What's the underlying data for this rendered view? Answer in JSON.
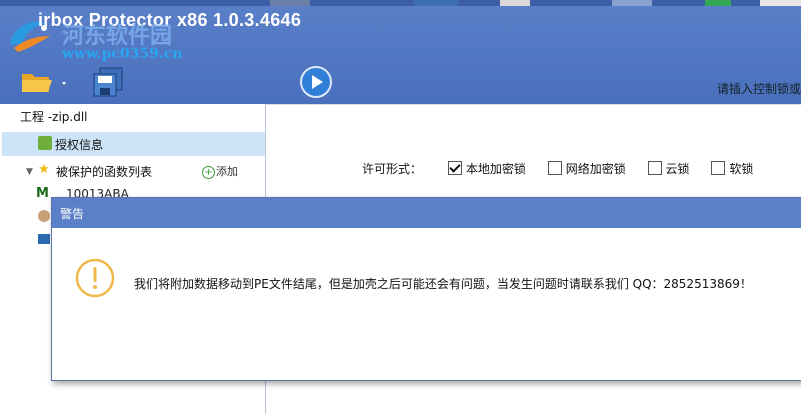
{
  "window": {
    "title": "irbox Protector x86  1.0.3.4646",
    "watermark_line1": "河东软件园",
    "watermark_line2": "www.pc0359.cn",
    "hint": "请插入控制锁或"
  },
  "toolbar": {
    "open_icon": "folder-open-icon",
    "save_icon": "save-all-icon",
    "run_icon": "play-icon"
  },
  "tree": {
    "project": "工程 -zip.dll",
    "auth_info": "授权信息",
    "protected_funcs": "被保护的函数列表",
    "add_label": "添加",
    "func1": "10013ABA"
  },
  "license": {
    "label": "许可形式：",
    "options": [
      {
        "label": "本地加密锁",
        "checked": true
      },
      {
        "label": "网络加密锁",
        "checked": false
      },
      {
        "label": "云锁",
        "checked": false
      },
      {
        "label": "软锁",
        "checked": false
      }
    ]
  },
  "dialog": {
    "title": "警告",
    "message": "我们将附加数据移动到PE文件结尾，但是加壳之后可能还会有问题，当发生问题时请联系我们 QQ：2852513869！"
  },
  "colors": {
    "titlebar": "#5b80c9",
    "selection": "#cde3f7",
    "warning": "#f0b84a"
  }
}
